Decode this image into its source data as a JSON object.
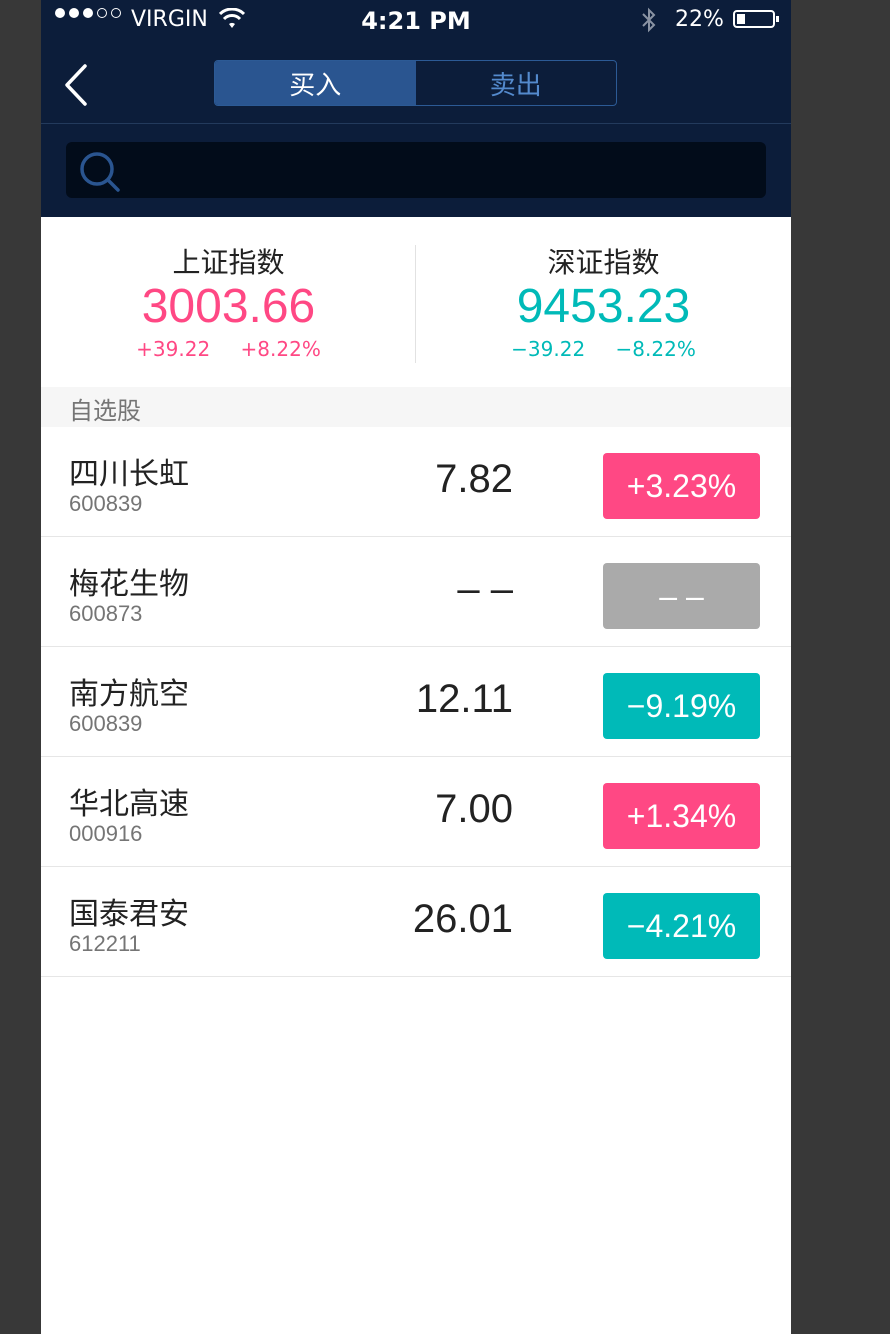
{
  "status": {
    "carrier": "VIRGIN",
    "time": "4:21 PM",
    "battery": "22%"
  },
  "header": {
    "tabs": [
      {
        "label": "买入",
        "active": true
      },
      {
        "label": "卖出",
        "active": false
      }
    ]
  },
  "search": {
    "placeholder": ""
  },
  "indices": [
    {
      "name": "上证指数",
      "value": "3003.66",
      "change": "+39.22",
      "percent": "+8.22%",
      "trend": "up"
    },
    {
      "name": "深证指数",
      "value": "9453.23",
      "change": "−39.22",
      "percent": "−8.22%",
      "trend": "down"
    }
  ],
  "section": {
    "title": "自选股"
  },
  "stocks": [
    {
      "name": "四川长虹",
      "code": "600839",
      "price": "7.82",
      "change": "+3.23%",
      "trend": "up"
    },
    {
      "name": "梅花生物",
      "code": "600873",
      "price": "– –",
      "change": "– –",
      "trend": "flat"
    },
    {
      "name": "南方航空",
      "code": "600839",
      "price": "12.11",
      "change": "−9.19%",
      "trend": "down"
    },
    {
      "name": "华北高速",
      "code": "000916",
      "price": "7.00",
      "change": "+1.34%",
      "trend": "up"
    },
    {
      "name": "国泰君安",
      "code": "612211",
      "price": "26.01",
      "change": "−4.21%",
      "trend": "down"
    }
  ],
  "colors": {
    "up": "#ff4884",
    "down": "#00bab8",
    "flat": "#aaaaaa",
    "text_primary": "#222222",
    "text_secondary": "#757575",
    "section_bg": "#f6f6f6",
    "tab_inactive": "#548acd"
  },
  "icons": {
    "back": "chevron-left-icon",
    "search": "search-icon",
    "wifi": "wifi-icon",
    "bluetooth": "bluetooth-icon",
    "battery": "battery-icon"
  }
}
